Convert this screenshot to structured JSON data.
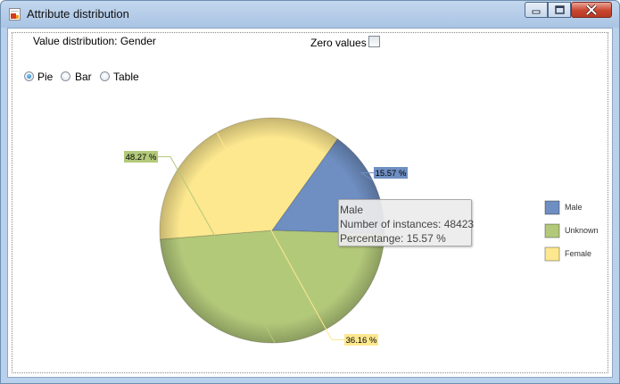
{
  "window": {
    "title": "Attribute distribution"
  },
  "header": {
    "title": "Value distribution: Gender",
    "zero_values_label": "Zero values",
    "zero_values_checked": false
  },
  "view_modes": [
    {
      "label": "Pie",
      "selected": true
    },
    {
      "label": "Bar",
      "selected": false
    },
    {
      "label": "Table",
      "selected": false
    }
  ],
  "tooltip": {
    "category": "Male",
    "instances_text": "Number of instances: 48423",
    "percentage_text": "Percentange: 15.57 %"
  },
  "chart_data": {
    "type": "pie",
    "categories": [
      "Male",
      "Unknown",
      "Female"
    ],
    "values": [
      15.57,
      48.27,
      36.16
    ],
    "labels": [
      "15.57 %",
      "48.27 %",
      "36.16 %"
    ],
    "colors": [
      "#6f8fc2",
      "#b3c97a",
      "#fde88f"
    ],
    "legend_placement": "right"
  }
}
